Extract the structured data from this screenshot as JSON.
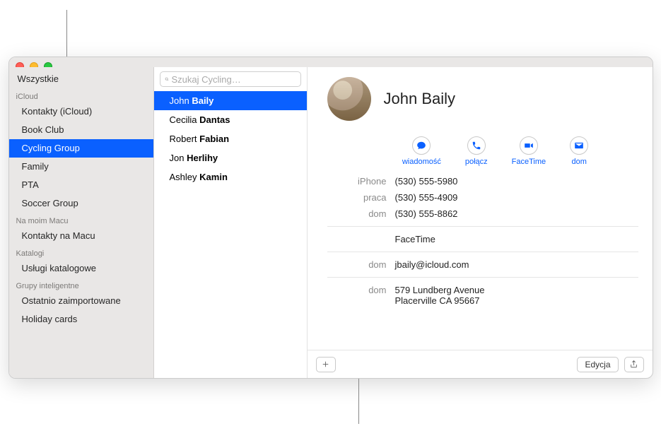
{
  "sidebar": {
    "all_label": "Wszystkie",
    "sections": [
      {
        "header": "iCloud",
        "items": [
          "Kontakty (iCloud)",
          "Book Club",
          "Cycling Group",
          "Family",
          "PTA",
          "Soccer Group"
        ],
        "selected_index": 2
      },
      {
        "header": "Na moim Macu",
        "items": [
          "Kontakty na Macu"
        ]
      },
      {
        "header": "Katalogi",
        "items": [
          "Usługi katalogowe"
        ]
      },
      {
        "header": "Grupy inteligentne",
        "items": [
          "Ostatnio zaimportowane",
          "Holiday cards"
        ]
      }
    ]
  },
  "search": {
    "placeholder": "Szukaj Cycling…"
  },
  "contacts": [
    {
      "first": "John",
      "last": "Baily",
      "selected": true
    },
    {
      "first": "Cecilia",
      "last": "Dantas",
      "selected": false
    },
    {
      "first": "Robert",
      "last": "Fabian",
      "selected": false
    },
    {
      "first": "Jon",
      "last": "Herlihy",
      "selected": false
    },
    {
      "first": "Ashley",
      "last": "Kamin",
      "selected": false
    }
  ],
  "card": {
    "name": "John Baily",
    "actions": {
      "message": "wiadomość",
      "call": "połącz",
      "facetime": "FaceTime",
      "mail": "dom"
    },
    "phones": [
      {
        "label": "iPhone",
        "value": "(530) 555-5980"
      },
      {
        "label": "praca",
        "value": "(530) 555-4909"
      },
      {
        "label": "dom",
        "value": "(530) 555-8862"
      }
    ],
    "facetime_label": "FaceTime",
    "email": {
      "label": "dom",
      "value": "jbaily@icloud.com"
    },
    "address": {
      "label": "dom",
      "line1": "579 Lundberg Avenue",
      "line2": "Placerville CA 95667"
    },
    "buttons": {
      "edit": "Edycja"
    }
  }
}
